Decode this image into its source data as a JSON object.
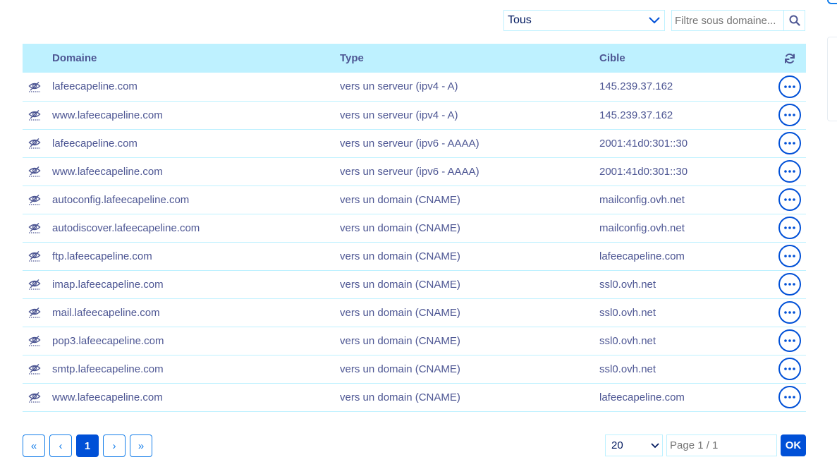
{
  "toolbar": {
    "type_filter": {
      "selected": "Tous"
    },
    "subdomain_filter": {
      "placeholder": "Filtre sous domaine..."
    }
  },
  "table": {
    "headers": {
      "domain": "Domaine",
      "type": "Type",
      "target": "Cible"
    },
    "rows": [
      {
        "domain": "lafeecapeline.com",
        "type": "vers un serveur (ipv4 - A)",
        "target": "145.239.37.162"
      },
      {
        "domain": "www.lafeecapeline.com",
        "type": "vers un serveur (ipv4 - A)",
        "target": "145.239.37.162"
      },
      {
        "domain": "lafeecapeline.com",
        "type": "vers un serveur (ipv6 - AAAA)",
        "target": "2001:41d0:301::30"
      },
      {
        "domain": "www.lafeecapeline.com",
        "type": "vers un serveur (ipv6 - AAAA)",
        "target": "2001:41d0:301::30"
      },
      {
        "domain": "autoconfig.lafeecapeline.com",
        "type": "vers un domain (CNAME)",
        "target": "mailconfig.ovh.net"
      },
      {
        "domain": "autodiscover.lafeecapeline.com",
        "type": "vers un domain (CNAME)",
        "target": "mailconfig.ovh.net"
      },
      {
        "domain": "ftp.lafeecapeline.com",
        "type": "vers un domain (CNAME)",
        "target": "lafeecapeline.com"
      },
      {
        "domain": "imap.lafeecapeline.com",
        "type": "vers un domain (CNAME)",
        "target": "ssl0.ovh.net"
      },
      {
        "domain": "mail.lafeecapeline.com",
        "type": "vers un domain (CNAME)",
        "target": "ssl0.ovh.net"
      },
      {
        "domain": "pop3.lafeecapeline.com",
        "type": "vers un domain (CNAME)",
        "target": "ssl0.ovh.net"
      },
      {
        "domain": "smtp.lafeecapeline.com",
        "type": "vers un domain (CNAME)",
        "target": "ssl0.ovh.net"
      },
      {
        "domain": "www.lafeecapeline.com",
        "type": "vers un domain (CNAME)",
        "target": "lafeecapeline.com"
      }
    ]
  },
  "pagination": {
    "first": "«",
    "prev": "‹",
    "current": "1",
    "next": "›",
    "last": "»",
    "per_page": "20",
    "page_input_placeholder": "Page 1 / 1",
    "ok_label": "OK"
  },
  "icons": {
    "row_visibility": "eye-slash-icon",
    "refresh": "refresh-icon",
    "row_actions": "more-horizontal-icon",
    "search": "search-icon",
    "dropdown": "chevron-down-icon"
  },
  "colors": {
    "header_bg": "#bef1ff",
    "text": "#4d5693",
    "primary": "#0050d7",
    "link": "#157eea"
  }
}
